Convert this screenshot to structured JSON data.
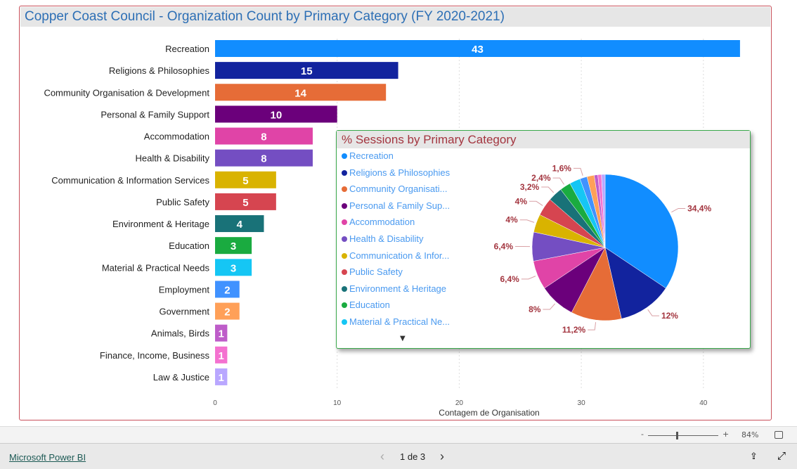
{
  "chart_data": [
    {
      "type": "bar",
      "orientation": "horizontal",
      "title": "Copper Coast Council - Organization Count by Primary Category (FY 2020-2021)",
      "xlabel": "Contagem de Organisation",
      "ylabel": "",
      "xlim": [
        0,
        43
      ],
      "xticks": [
        0,
        10,
        20,
        30,
        40
      ],
      "grid": "vertical dotted",
      "categories": [
        "Recreation",
        "Religions & Philosophies",
        "Community Organisation & Development",
        "Personal & Family Support",
        "Accommodation",
        "Health & Disability",
        "Communication & Information Services",
        "Public Safety",
        "Environment & Heritage",
        "Education",
        "Material & Practical Needs",
        "Employment",
        "Government",
        "Animals, Birds",
        "Finance, Income, Business",
        "Law & Justice"
      ],
      "values": [
        43,
        15,
        14,
        10,
        8,
        8,
        5,
        5,
        4,
        3,
        3,
        2,
        2,
        1,
        1,
        1
      ],
      "colors": [
        "#118DFF",
        "#12239E",
        "#E66C37",
        "#6B007B",
        "#E044A7",
        "#744EC2",
        "#D9B300",
        "#D64550",
        "#197278",
        "#1AAB40",
        "#15C6F4",
        "#4092FF",
        "#FFA058",
        "#BE5DC9",
        "#F472D0",
        "#B9A7FF"
      ]
    },
    {
      "type": "pie",
      "title": "% Sessions by Primary Category",
      "legend": [
        "Recreation",
        "Religions & Philosophies",
        "Community Organisati...",
        "Personal & Family Sup...",
        "Accommodation",
        "Health & Disability",
        "Communication & Infor...",
        "Public Safety",
        "Environment & Heritage",
        "Education",
        "Material & Practical Ne..."
      ],
      "values": [
        34.4,
        12,
        11.2,
        8,
        6.4,
        6.4,
        4,
        4,
        3.2,
        2.4,
        2.4,
        1.6,
        1.6,
        0.8,
        0.8,
        0.8
      ],
      "labels": [
        "34,4%",
        "12%",
        "11,2%",
        "8%",
        "6,4%",
        "6,4%",
        "4%",
        "4%",
        "3,2%",
        "2,4%",
        null,
        "1,6%",
        null,
        null,
        null,
        null
      ]
    }
  ],
  "zoom": {
    "minus": "-",
    "plus": "+",
    "level": "84%"
  },
  "footer": {
    "brand": "Microsoft Power BI",
    "page": "1 de 3",
    "prev": "‹",
    "next": "›"
  }
}
